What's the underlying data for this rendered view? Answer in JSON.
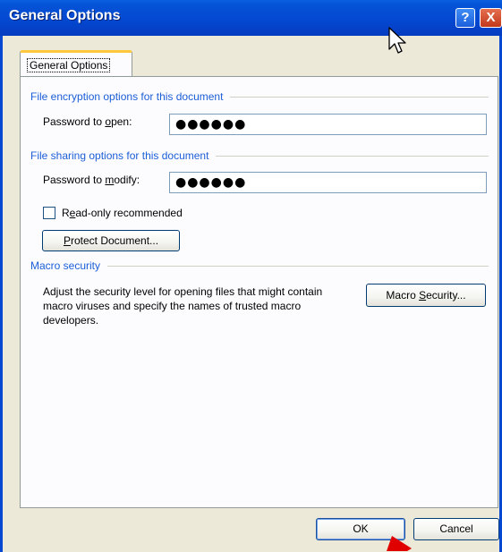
{
  "window": {
    "title": "General Options",
    "help_label": "?",
    "close_label": "X"
  },
  "tab": {
    "label": "General Options"
  },
  "encryption": {
    "heading": "File encryption options for this document",
    "password_label_pre": "Password to ",
    "password_label_key": "o",
    "password_label_post": "pen:",
    "password_value": "●●●●●●"
  },
  "sharing": {
    "heading": "File sharing options for this document",
    "password_label_pre": "Password to ",
    "password_label_key": "m",
    "password_label_post": "odify:",
    "password_value": "●●●●●●",
    "readonly_pre": "R",
    "readonly_key": "e",
    "readonly_post": "ad-only recommended",
    "readonly_checked": false,
    "protect_key": "P",
    "protect_post": "rotect Document..."
  },
  "macro": {
    "heading": "Macro security",
    "description": "Adjust the security level for opening files that might contain macro viruses and specify the names of trusted macro developers.",
    "button_pre": "Macro ",
    "button_key": "S",
    "button_post": "ecurity..."
  },
  "footer": {
    "ok_label": "OK",
    "cancel_label": "Cancel"
  },
  "colors": {
    "titlebar": "#0447d0",
    "group_heading": "#1b5ed6",
    "dialog_bg": "#ece9d8",
    "annotation_arrow": "#e00000"
  },
  "icons": {
    "cursor": "mouse-pointer-icon",
    "annotation": "red-arrow-icon"
  }
}
